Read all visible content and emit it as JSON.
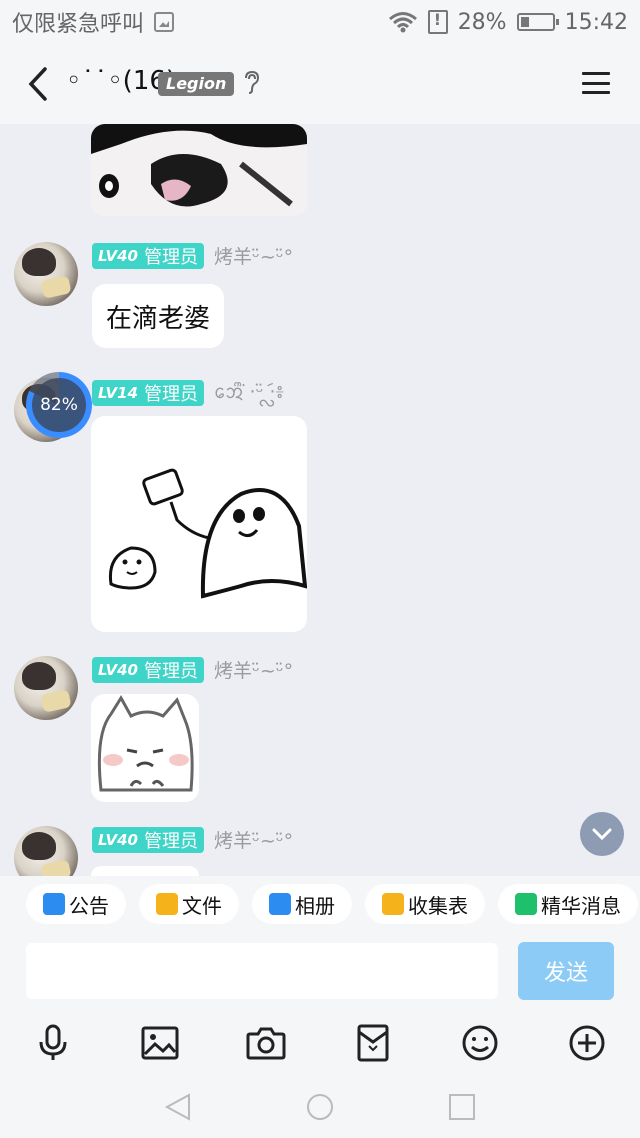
{
  "status_bar": {
    "carrier_text": "仅限紧急呼叫",
    "battery_percent": "28%",
    "time": "15:42"
  },
  "header": {
    "title": "◦˙˙◦(16)",
    "badge": "Legion"
  },
  "messages": [
    {
      "level": "LV40",
      "role": "管理员",
      "nickname": "烤羊ᵕ̈~ᵕ̈°",
      "text": "在滴老婆"
    },
    {
      "level": "LV14",
      "role": "管理员",
      "nickname": "ᩋᩮᩨ̇ ·ᵕ̈ ·ᩖᩢ៖",
      "upload_progress": "82%"
    },
    {
      "level": "LV40",
      "role": "管理员",
      "nickname": "烤羊ᵕ̈~ᵕ̈°"
    },
    {
      "level": "LV40",
      "role": "管理员",
      "nickname": "烤羊ᵕ̈~ᵕ̈°"
    }
  ],
  "quick_actions": [
    "公告",
    "文件",
    "相册",
    "收集表",
    "精华消息"
  ],
  "input": {
    "placeholder": "",
    "send_label": "发送"
  },
  "tools": [
    "microphone-icon",
    "image-icon",
    "camera-icon",
    "red-packet-icon",
    "emoji-icon",
    "plus-icon"
  ],
  "colors": {
    "level_badge": "#3fd4c8",
    "send_disabled": "#8ccbf5",
    "progress": "#3a8dff"
  }
}
